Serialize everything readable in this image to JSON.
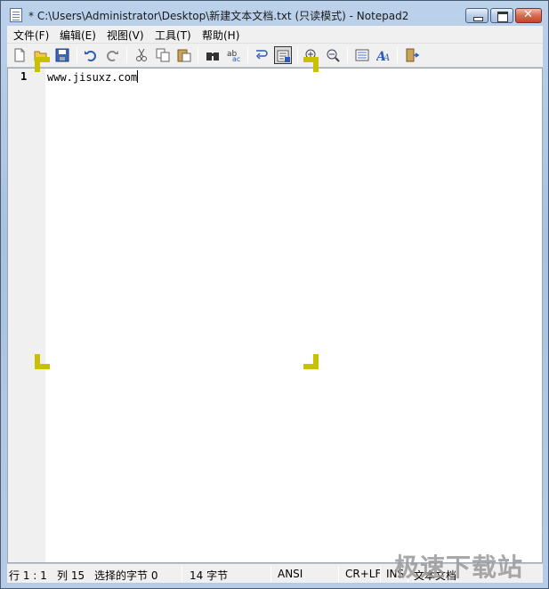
{
  "window": {
    "title": "* C:\\Users\\Administrator\\Desktop\\新建文本文档.txt (只读模式) - Notepad2"
  },
  "menu": [
    "文件(F)",
    "编辑(E)",
    "视图(V)",
    "工具(T)",
    "帮助(H)"
  ],
  "toolbar": {
    "icons": [
      "new-file-icon",
      "open-file-icon",
      "save-icon",
      "undo-icon",
      "redo-icon",
      "cut-icon",
      "copy-icon",
      "paste-icon",
      "find-icon",
      "replace-icon",
      "word-wrap-icon",
      "read-only-icon",
      "zoom-in-icon",
      "zoom-out-icon",
      "scheme-icon",
      "font-icon",
      "exit-icon"
    ],
    "selected": "read-only-icon"
  },
  "editor": {
    "lines": [
      {
        "number": "1",
        "text": "www.jisuxz.com"
      }
    ]
  },
  "status": {
    "position": "行 1 : 1",
    "column": "列 15",
    "selection": "选择的字节 0",
    "size": "14 字节",
    "encoding": "ANSI",
    "eol": "CR+LF",
    "mode": "INS",
    "type": "文本文档"
  },
  "watermark": "极速下载站",
  "colors": {
    "marker": "#c8c000",
    "gutter": "#f0f0f0"
  }
}
